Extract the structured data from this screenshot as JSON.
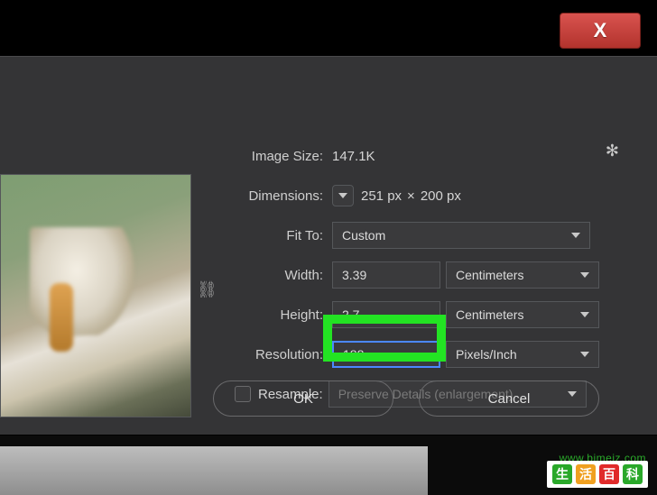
{
  "close": {
    "glyph": "X"
  },
  "gear": {
    "glyph": "✻"
  },
  "imageSize": {
    "label": "Image Size:",
    "value": "147.1K"
  },
  "dimensions": {
    "label": "Dimensions:",
    "w": "251 px",
    "x": "×",
    "h": "200 px"
  },
  "fitTo": {
    "label": "Fit To:",
    "value": "Custom"
  },
  "width": {
    "label": "Width:",
    "value": "3.39",
    "unit": "Centimeters"
  },
  "height": {
    "label": "Height:",
    "value": "2.7",
    "unit": "Centimeters"
  },
  "resolution": {
    "label": "Resolution:",
    "value": "188",
    "unit": "Pixels/Inch"
  },
  "resample": {
    "label": "Resample:",
    "method": "Preserve Details (enlargement)"
  },
  "buttons": {
    "ok": "OK",
    "cancel": "Cancel"
  },
  "watermark": {
    "chars": [
      "生",
      "活",
      "百",
      "科"
    ],
    "url": "www.bimeiz.com"
  }
}
